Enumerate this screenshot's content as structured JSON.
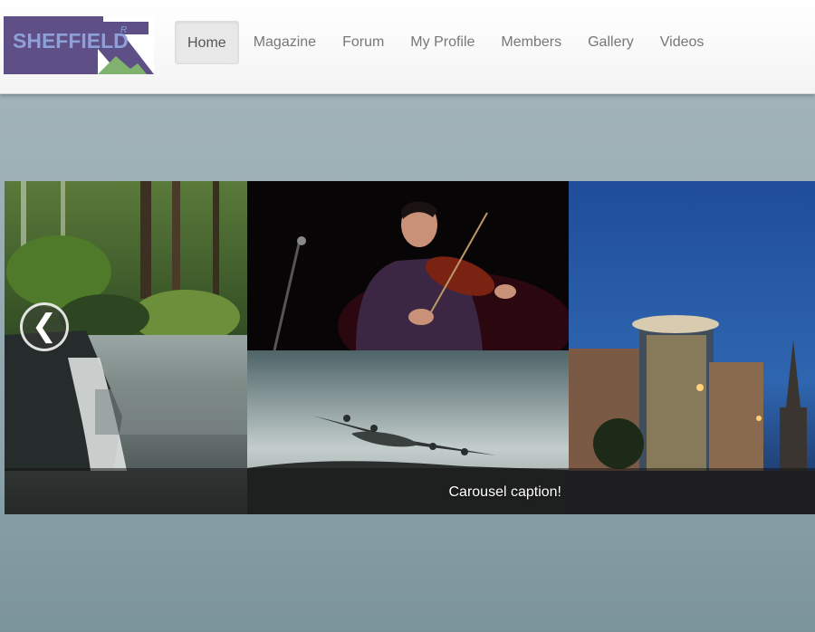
{
  "logo": {
    "text": "SHEFFIELD",
    "superscript": "R"
  },
  "nav": {
    "items": [
      {
        "label": "Home"
      },
      {
        "label": "Magazine"
      },
      {
        "label": "Forum"
      },
      {
        "label": "My Profile"
      },
      {
        "label": "Members"
      },
      {
        "label": "Gallery"
      },
      {
        "label": "Videos"
      }
    ],
    "active_index": 0
  },
  "carousel": {
    "caption": "Carousel caption!",
    "prev_icon": "chevron-left-icon",
    "photos": [
      "waterfall-forest-photo",
      "violinist-photo",
      "lancaster-bomber-photo",
      "city-building-night-photo"
    ]
  },
  "colors": {
    "logo_purple": "#5e4f86",
    "logo_blue": "#8ea0d8",
    "logo_green": "#7fb26d"
  }
}
